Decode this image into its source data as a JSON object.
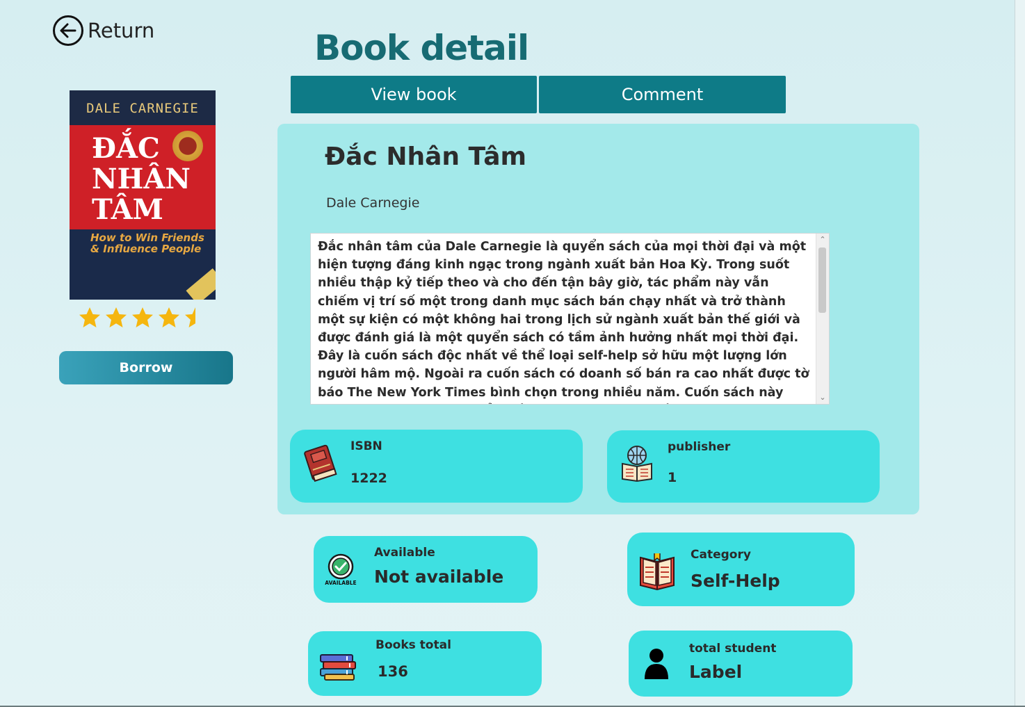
{
  "nav": {
    "return_label": "Return"
  },
  "page_title": "Book detail",
  "tabs": [
    {
      "label": "View book"
    },
    {
      "label": "Comment"
    }
  ],
  "cover": {
    "author": "DALE CARNEGIE",
    "title_lines": [
      "ĐẮC",
      "NHÂN",
      "TÂM"
    ],
    "subtitle": "How to Win Friends & Influence People"
  },
  "rating": {
    "stars": 4.5,
    "max": 5
  },
  "borrow_label": "Borrow",
  "book": {
    "title": "Đắc Nhân Tâm",
    "author": "Dale Carnegie",
    "description": "Đắc nhân tâm của Dale Carnegie là quyển sách của mọi thời đại và một hiện tượng đáng kinh ngạc trong ngành xuất bản Hoa Kỳ. Trong suốt nhiều thập kỷ tiếp theo và cho đến tận bây giờ, tác phẩm này vẫn chiếm vị trí số một trong danh mục sách bán chạy nhất và trở thành một sự kiện có một không hai trong lịch sử ngành xuất bản thế giới và được đánh giá là một quyển sách có tầm ảnh hưởng nhất mọi thời đại. Đây là cuốn sách độc nhất về thể loại self-help sở hữu một lượng lớn người hâm mộ. Ngoài ra cuốn sách có doanh số bán ra cao nhất được tờ báo The New York Times bình chọn trong nhiều năm. Cuốn sách này không còn là một tác phẩm về nghệ thuật đơn thuần nữa mà là một bước thay đổi lớn trong cách nhìn nhận và cách sống của nhiều thế hệ."
  },
  "info": {
    "isbn": {
      "label": "ISBN",
      "value": "1222",
      "icon": "book-icon"
    },
    "publisher": {
      "label": "publisher",
      "value": "1",
      "icon": "globe-book-icon"
    },
    "available": {
      "label": "Available",
      "value": "Not available",
      "icon": "available-badge-icon",
      "badge_text": "AVAILABLE"
    },
    "category": {
      "label": "Category",
      "value": "Self-Help",
      "icon": "open-book-icon"
    },
    "books_total": {
      "label": "Books total",
      "value": "136",
      "icon": "book-stack-icon"
    },
    "total_student": {
      "label": "total student",
      "value": "Label",
      "icon": "person-icon"
    }
  },
  "colors": {
    "title": "#176b73",
    "tab_bg": "#0e7b87",
    "panel_bg": "#a3e9ea",
    "card_bg": "#3ee0e1",
    "star": "#f5b60f"
  }
}
